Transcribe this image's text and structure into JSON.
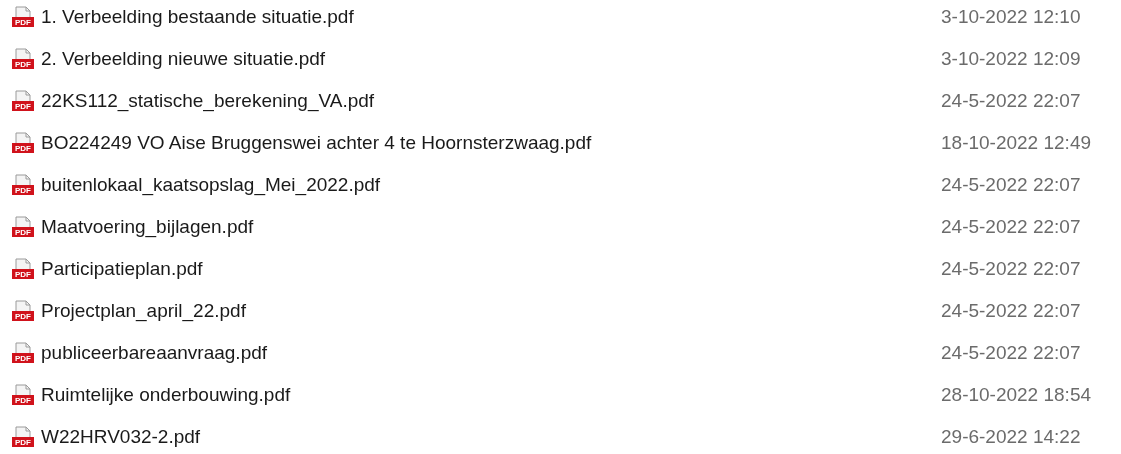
{
  "files": [
    {
      "icon_label": "PDF",
      "name": "1. Verbeelding bestaande situatie.pdf",
      "modified": "3-10-2022 12:10"
    },
    {
      "icon_label": "PDF",
      "name": "2. Verbeelding nieuwe situatie.pdf",
      "modified": "3-10-2022 12:09"
    },
    {
      "icon_label": "PDF",
      "name": "22KS112_statische_berekening_VA.pdf",
      "modified": "24-5-2022 22:07"
    },
    {
      "icon_label": "PDF",
      "name": "BO224249 VO Aise Bruggenswei achter 4 te Hoornsterzwaag.pdf",
      "modified": "18-10-2022 12:49"
    },
    {
      "icon_label": "PDF",
      "name": "buitenlokaal_kaatsopslag_Mei_2022.pdf",
      "modified": "24-5-2022 22:07"
    },
    {
      "icon_label": "PDF",
      "name": "Maatvoering_bijlagen.pdf",
      "modified": "24-5-2022 22:07"
    },
    {
      "icon_label": "PDF",
      "name": "Participatieplan.pdf",
      "modified": "24-5-2022 22:07"
    },
    {
      "icon_label": "PDF",
      "name": "Projectplan_april_22.pdf",
      "modified": "24-5-2022 22:07"
    },
    {
      "icon_label": "PDF",
      "name": "publiceerbareaanvraag.pdf",
      "modified": "24-5-2022 22:07"
    },
    {
      "icon_label": "PDF",
      "name": "Ruimtelijke onderbouwing.pdf",
      "modified": "28-10-2022 18:54"
    },
    {
      "icon_label": "PDF",
      "name": "W22HRV032-2.pdf",
      "modified": "29-6-2022 14:22"
    }
  ]
}
